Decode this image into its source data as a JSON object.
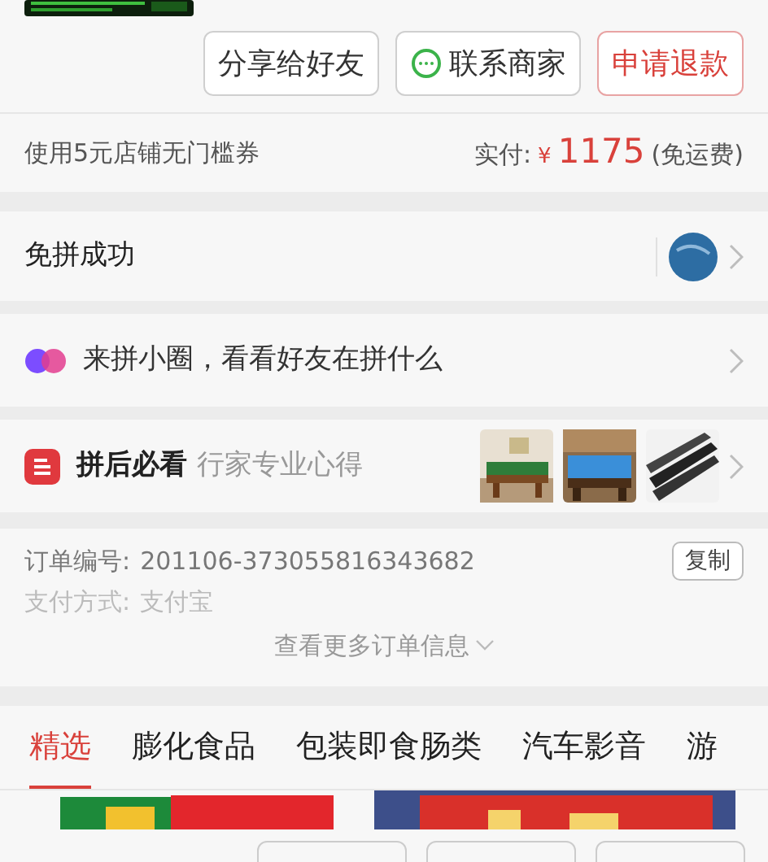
{
  "order_actions": [
    {
      "label": "分享给好友",
      "kind": "plain"
    },
    {
      "label": "联系商家",
      "kind": "chat"
    },
    {
      "label": "申请退款",
      "kind": "danger"
    }
  ],
  "payment": {
    "coupon": "使用5元店铺无门槛券",
    "paid_label": "实付:",
    "currency": "¥",
    "amount": "1175",
    "shipping": "(免运费)"
  },
  "group_status": {
    "title": "免拼成功"
  },
  "circle": {
    "text": "来拼小圈，看看好友在拼什么"
  },
  "guide": {
    "title": "拼后必看",
    "subtitle": "行家专业心得"
  },
  "order_info": {
    "number_label": "订单编号:",
    "number": "201106-373055816343682",
    "copy": "复制",
    "pay_label": "支付方式:",
    "pay_method": "支付宝",
    "more": "查看更多订单信息"
  },
  "tabs": [
    {
      "label": "精选",
      "selected": true
    },
    {
      "label": "膨化食品",
      "selected": false
    },
    {
      "label": "包装即食肠类",
      "selected": false
    },
    {
      "label": "汽车影音",
      "selected": false
    },
    {
      "label": "游",
      "selected": false
    }
  ]
}
